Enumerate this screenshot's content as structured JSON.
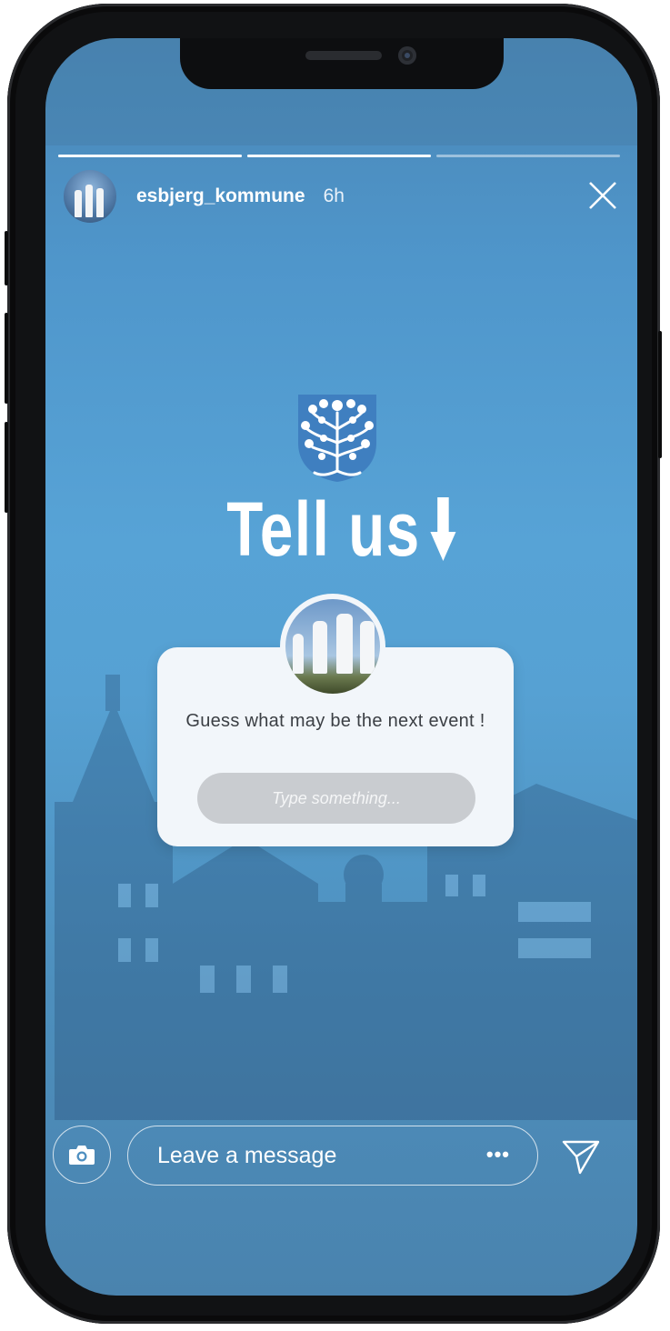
{
  "story": {
    "progress": [
      1,
      1,
      0
    ],
    "username": "esbjerg_kommune",
    "time_ago": "6h",
    "icons": {
      "close": "close-icon",
      "crest": "esbjerg-crest-icon",
      "arrow": "arrow-down-icon"
    }
  },
  "content": {
    "title": "Tell us",
    "question_card": {
      "question": "Guess what may be the next event !",
      "placeholder": "Type something..."
    }
  },
  "reply_bar": {
    "message_placeholder": "Leave a message",
    "more_label": "•••",
    "icons": {
      "camera": "camera-icon",
      "send": "send-icon"
    }
  },
  "colors": {
    "background_blue": "#56a1d3",
    "card": "#f2f6fa",
    "input": "#c9ccd0"
  }
}
